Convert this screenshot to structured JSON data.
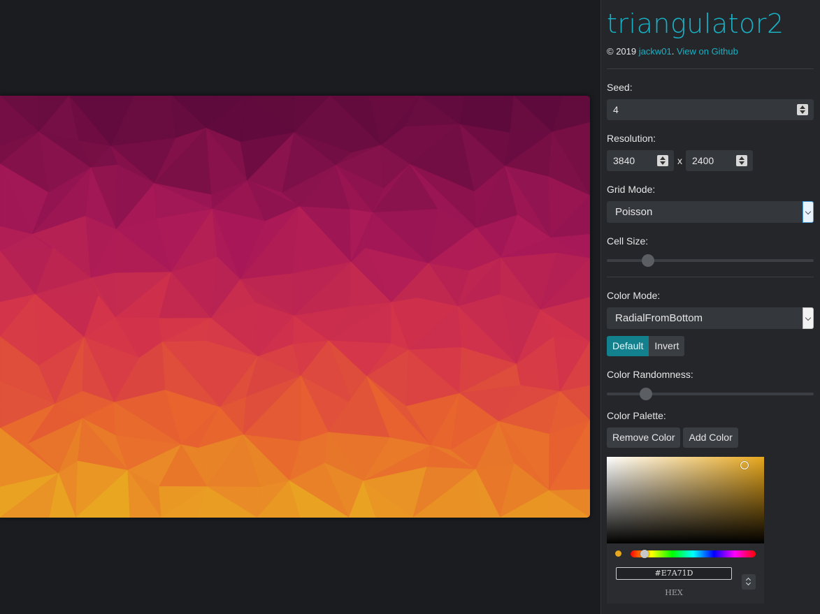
{
  "app": {
    "title": "triangulator2",
    "credit_prefix": "© 2019 ",
    "author_link": "jackw01",
    "credit_sep": ". ",
    "github_link": "View on Github"
  },
  "colors": {
    "accent": "#1ab0c4",
    "active_button": "#13808e",
    "panel_bg": "#24262a",
    "page_bg": "#1a1c20"
  },
  "controls": {
    "seed_label": "Seed:",
    "seed_value": "4",
    "resolution_label": "Resolution:",
    "resolution_width": "3840",
    "resolution_x": "x",
    "resolution_height": "2400",
    "grid_mode_label": "Grid Mode:",
    "grid_mode_value": "Poisson",
    "cell_size_label": "Cell Size:",
    "cell_size_level": 0.18,
    "color_mode_label": "Color Mode:",
    "color_mode_value": "RadialFromBottom",
    "default_button": "Default",
    "invert_button": "Invert",
    "color_randomness_label": "Color Randomness:",
    "color_randomness_level": 0.17,
    "color_palette_label": "Color Palette:",
    "remove_color_button": "Remove Color",
    "add_color_button": "Add Color"
  },
  "color_picker": {
    "hex_value": "#E7A71D",
    "hex_label": "HEX",
    "selected_color": "#e7a71d"
  }
}
